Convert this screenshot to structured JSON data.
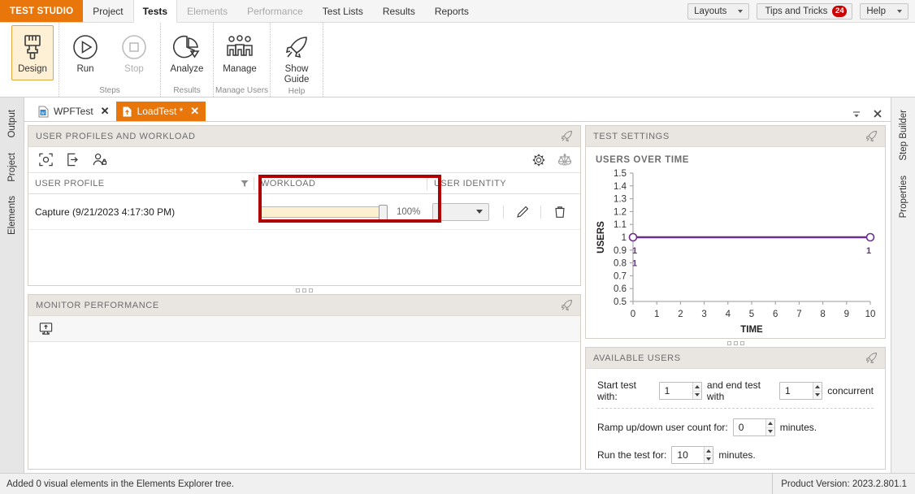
{
  "menubar": {
    "brand": "TEST STUDIO",
    "items": [
      {
        "label": "Project",
        "state": "normal"
      },
      {
        "label": "Tests",
        "state": "active"
      },
      {
        "label": "Elements",
        "state": "disabled"
      },
      {
        "label": "Performance",
        "state": "disabled"
      },
      {
        "label": "Test Lists",
        "state": "normal"
      },
      {
        "label": "Results",
        "state": "normal"
      },
      {
        "label": "Reports",
        "state": "normal"
      }
    ],
    "layouts_label": "Layouts",
    "tips_label": "Tips and Tricks",
    "tips_badge": "24",
    "help_label": "Help"
  },
  "ribbon": {
    "groups": [
      {
        "label": "",
        "buttons": [
          {
            "label": "Design",
            "icon": "paintbrush-icon",
            "state": "selected"
          }
        ]
      },
      {
        "label": "Steps",
        "buttons": [
          {
            "label": "Run",
            "icon": "play-circle-icon",
            "state": "normal"
          },
          {
            "label": "Stop",
            "icon": "stop-circle-icon",
            "state": "disabled"
          }
        ]
      },
      {
        "label": "Results",
        "buttons": [
          {
            "label": "Analyze",
            "icon": "pie-chart-icon",
            "state": "normal"
          }
        ]
      },
      {
        "label": "Manage Users",
        "buttons": [
          {
            "label": "Manage",
            "icon": "users-group-icon",
            "state": "normal"
          }
        ]
      },
      {
        "label": "Help",
        "buttons": [
          {
            "label": "Show Guide",
            "icon": "rocket-icon",
            "state": "normal"
          }
        ]
      }
    ]
  },
  "left_dock": {
    "tabs": [
      "Output",
      "Project",
      "Elements"
    ]
  },
  "right_dock": {
    "tabs": [
      "Step Builder",
      "Properties"
    ]
  },
  "doc_tabs": {
    "tabs": [
      {
        "label": "WPFTest",
        "icon": "word-doc-icon",
        "active": false,
        "modified": false,
        "close": "✕"
      },
      {
        "label": "LoadTest *",
        "icon": "upload-doc-icon",
        "active": true,
        "modified": true,
        "close": "✕"
      }
    ],
    "menu_icon": "dropdown-menu-icon",
    "close_icon": "close-icon"
  },
  "user_profiles_panel": {
    "title": "USER PROFILES AND WORKLOAD",
    "pin_icon": "rocket-pin-icon",
    "toolbar": [
      {
        "name": "capture-icon",
        "title": "Capture"
      },
      {
        "name": "import-icon",
        "title": "Import"
      },
      {
        "name": "user-identity-icon",
        "title": "User Identity"
      }
    ],
    "toolbar_right": [
      {
        "name": "gear-icon",
        "title": "Settings"
      },
      {
        "name": "balance-scales-icon",
        "title": "Balance"
      }
    ],
    "columns": [
      "USER PROFILE",
      "WORKLOAD",
      "USER IDENTITY"
    ],
    "filter_icon": "filter-icon",
    "rows": [
      {
        "profile": "Capture (9/21/2023 4:17:30 PM)",
        "workload_percent": "100%",
        "workload_value": 100,
        "identity": "",
        "edit_icon": "pencil-icon",
        "delete_icon": "trash-icon"
      }
    ]
  },
  "monitor_panel": {
    "title": "MONITOR PERFORMANCE",
    "pin_icon": "rocket-pin-icon",
    "toolbar": [
      {
        "name": "monitor-icon",
        "title": "Add monitor"
      }
    ]
  },
  "test_settings_panel": {
    "title": "TEST SETTINGS",
    "pin_icon": "rocket-pin-icon"
  },
  "available_users_panel": {
    "title": "AVAILABLE USERS",
    "pin_icon": "rocket-pin-icon",
    "start_label": "Start test with:",
    "start_value": "1",
    "end_label": "and end test with",
    "end_value": "1",
    "concurrent_label": "concurrent",
    "ramp_label": "Ramp up/down user count for:",
    "ramp_value": "0",
    "ramp_unit": "minutes.",
    "run_label": "Run the test for:",
    "run_value": "10",
    "run_unit": "minutes."
  },
  "statusbar": {
    "message": "Added 0 visual elements in the Elements Explorer tree.",
    "version": "Product Version: 2023.2.801.1"
  },
  "colors": {
    "brand_orange": "#e8760a",
    "highlight_red": "#b00000",
    "chart_line": "#6b2d8e",
    "badge_red": "#cc0000",
    "panel_header": "#e9e5e0",
    "slider_fill": "#fdf0d0"
  },
  "chart_data": {
    "type": "line",
    "title": "USERS OVER TIME",
    "xlabel": "TIME",
    "ylabel": "USERS",
    "x": [
      0,
      10
    ],
    "series": [
      {
        "name": "Users",
        "values": [
          1,
          1
        ],
        "color": "#6b2d8e"
      }
    ],
    "xticks": [
      0,
      1,
      2,
      3,
      4,
      5,
      6,
      7,
      8,
      9,
      10
    ],
    "yticks": [
      0.5,
      0.6,
      0.7,
      0.8,
      0.9,
      1,
      1.1,
      1.2,
      1.3,
      1.4,
      1.5
    ],
    "ytick_labels": [
      "0.5",
      "0.6",
      "0.7",
      "0.8",
      "0.9",
      "1",
      "1.1",
      "1.2",
      "1.3",
      "1.4",
      "1.5"
    ],
    "xtick_labels": [
      "0",
      "1",
      "2",
      "3",
      "4",
      "5",
      "6",
      "7",
      "8",
      "9",
      "10"
    ],
    "xlim": [
      0,
      10
    ],
    "ylim": [
      0.5,
      1.5
    ],
    "grid": false,
    "legend": "none",
    "endpoint_labels": [
      "1",
      "1"
    ]
  }
}
